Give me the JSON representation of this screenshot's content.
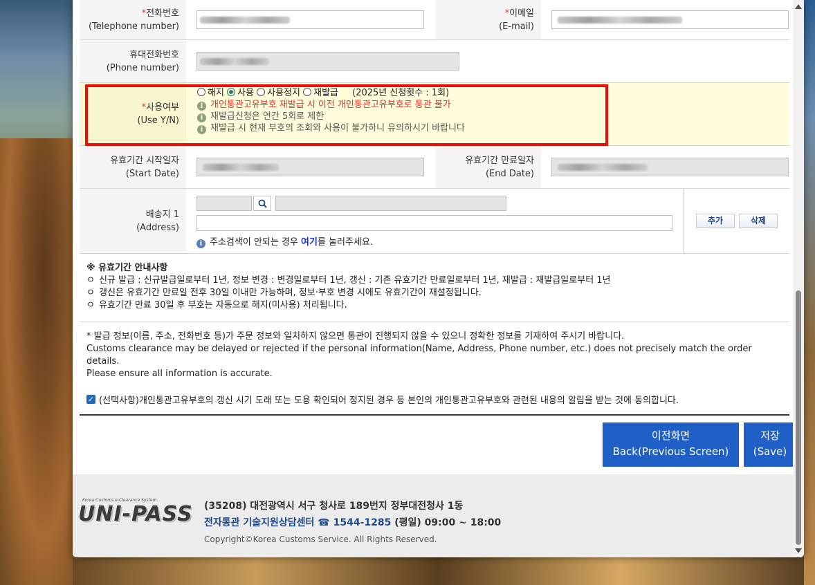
{
  "form": {
    "telephone": {
      "label_ko": "전화번호",
      "label_en": "(Telephone number)",
      "required": "*"
    },
    "email": {
      "label_ko": "이메일",
      "label_en": "(E-mail)",
      "required": "*"
    },
    "mobile": {
      "label_ko": "휴대전화번호",
      "label_en": "(Phone number)"
    },
    "use": {
      "label_ko": "사용여부",
      "label_en": "(Use Y/N)",
      "required": "*",
      "options": [
        "해지",
        "사용",
        "사용정지",
        "재발급"
      ],
      "selected": "사용",
      "count_text": "(2025년 신청횟수 : 1회)",
      "notes": [
        "개인통관고유부호 재발급 시 이전 개인통관고유부호로 통관 불가",
        "재발급신청은 연간 5회로 제한",
        "재발급 시 현재 부호의 조회와 사용이 불가하니 유의하시기 바랍니다"
      ]
    },
    "start_date": {
      "label_ko": "유효기간 시작일자",
      "label_en": "(Start Date)"
    },
    "end_date": {
      "label_ko": "유효기간 만료일자",
      "label_en": "(End Date)"
    },
    "address": {
      "label_ko": "배송지 1",
      "label_en": "(Address)",
      "help_before": "주소검색이 안되는 경우 ",
      "help_link": "여기",
      "help_after": "를 눌러주세요.",
      "add_label": "추가",
      "delete_label": "삭제"
    }
  },
  "notice": {
    "title": "※ 유효기간 안내사항",
    "items": [
      "신규 발급 : 신규발급일로부터 1년, 정보 변경 : 변경일로부터 1년, 갱신 : 기존 유효기간 만료일로부터 1년, 재발급 : 재발급일로부터 1년",
      "갱신은 유효기간 만료일 전후 30일 이내만 가능하며, 정보·부호 변경 시에도 유효기간이 재설정됩니다.",
      "유효기간 만료 30일 후 부호는 자동으로 해지(미사용) 처리됩니다."
    ],
    "bullet": "ㅇ"
  },
  "warning": {
    "ko": "* 발급 정보(이름, 주소, 전화번호 등)가 주문 정보와 일치하지 않으면 통관이 진행되지 않을 수 있으니 정확한 정보를 기재하여 주시기 바랍니다.",
    "en1": "Customs clearance may be delayed or rejected if the personal information(Name, Address, Phone number, etc.) does not precisely match the order details.",
    "en2": "Please ensure all information is accurate."
  },
  "consent": {
    "checked": true,
    "text": "(선택사항)개인통관고유부호의 갱신 시기 도래 또는 도용 확인되어 정지된 경우 등 본인의 개인통관고유부호와 관련된 내용의 알림을 받는 것에 동의합니다."
  },
  "buttons": {
    "back_ko": "이전화면",
    "back_en": "Back(Previous Screen)",
    "save_ko": "저장",
    "save_en": "(Save)"
  },
  "footer": {
    "logo_small": "Korea Customs e-Clearance System",
    "logo": "UNI-PASS",
    "address": "(35208) 대전광역시 서구 청사로 189번지 정부대전청사 1동",
    "helpdesk": "전자통관 기술지원상담센터 ☎ 1544-1285",
    "hours": "(평일) 09:00 ~ 18:00",
    "copyright": "Copyright©Korea Customs Service. All Rights Reserved."
  },
  "colors": {
    "accent_blue": "#1f5fc6",
    "highlight_box": "#ef0c0c",
    "note_red": "#e4312a",
    "use_row_bg": "#fefcdb"
  }
}
